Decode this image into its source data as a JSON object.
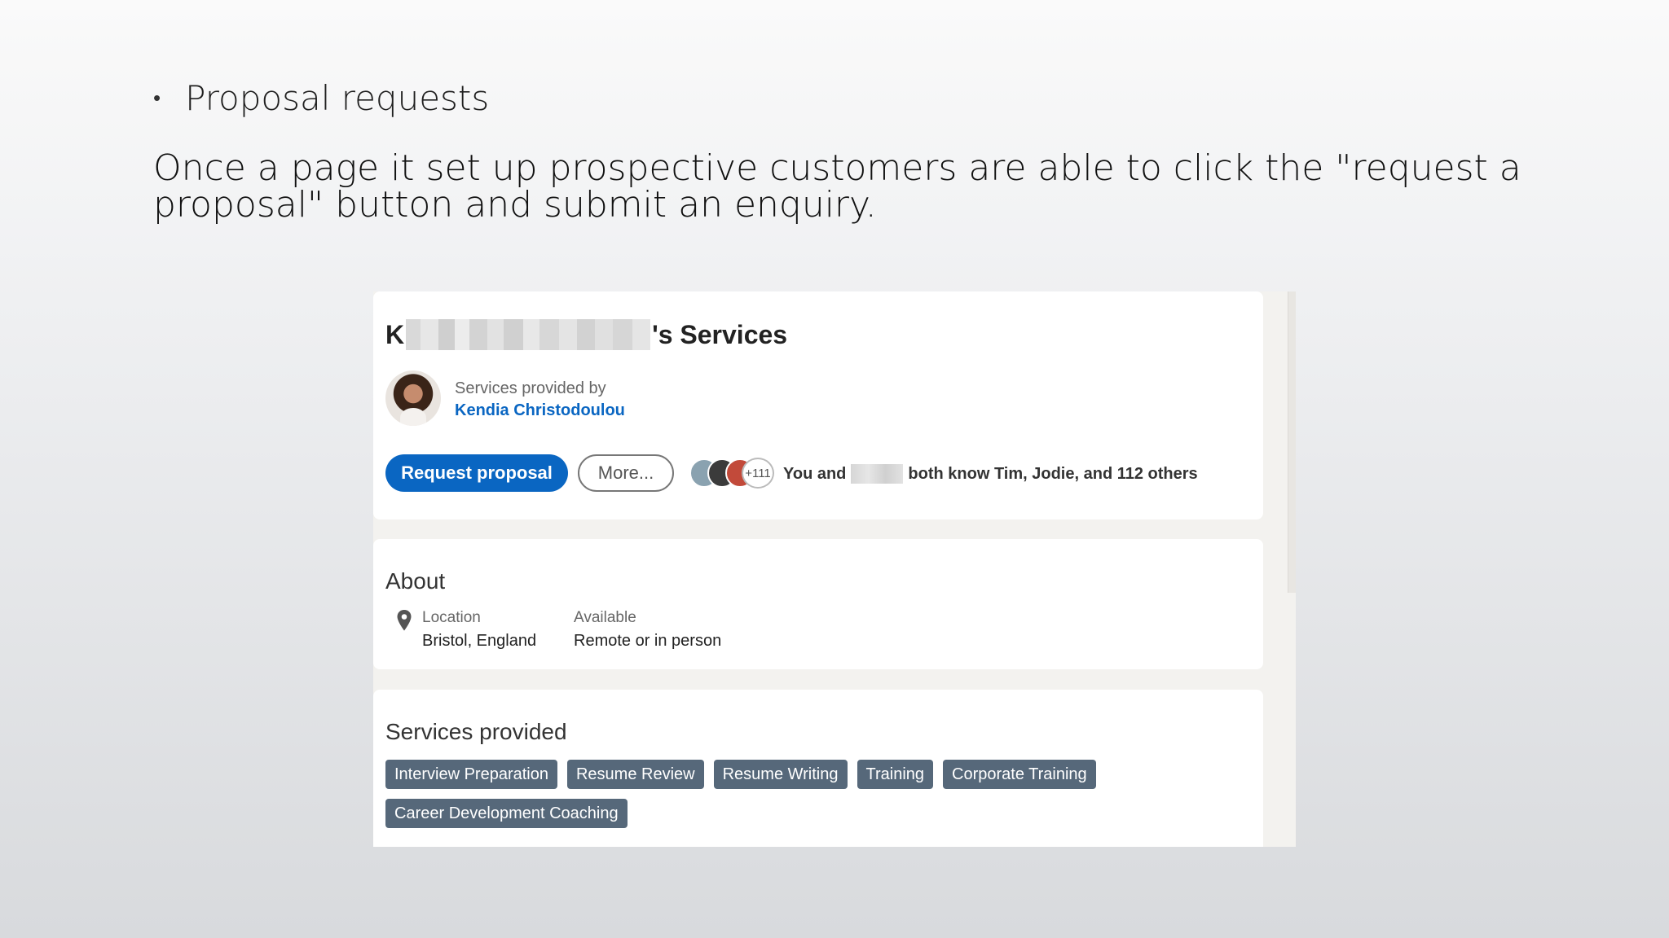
{
  "slide": {
    "bullet_title": "Proposal requests",
    "body": "Once a page it set up prospective customers are able to click the \"request a proposal\" button and submit an enquiry."
  },
  "profile": {
    "title_prefix": "K",
    "title_suffix": "'s Services",
    "provided_by_label": "Services provided by",
    "provider_name": "Kendia Christodoulou",
    "request_button": "Request proposal",
    "more_button": "More...",
    "mutual_count": "+111",
    "mutual_prefix": "You and",
    "mutual_suffix": "both know Tim, Jodie, and 112 others"
  },
  "about": {
    "heading": "About",
    "location_label": "Location",
    "location_value": "Bristol, England",
    "available_label": "Available",
    "available_value": "Remote or in person"
  },
  "services": {
    "heading": "Services provided",
    "items": [
      "Interview Preparation",
      "Resume Review",
      "Resume Writing",
      "Training",
      "Corporate Training",
      "Career Development Coaching"
    ]
  },
  "colors": {
    "brand_blue": "#0a66c2",
    "pill_bg": "#56687a"
  }
}
